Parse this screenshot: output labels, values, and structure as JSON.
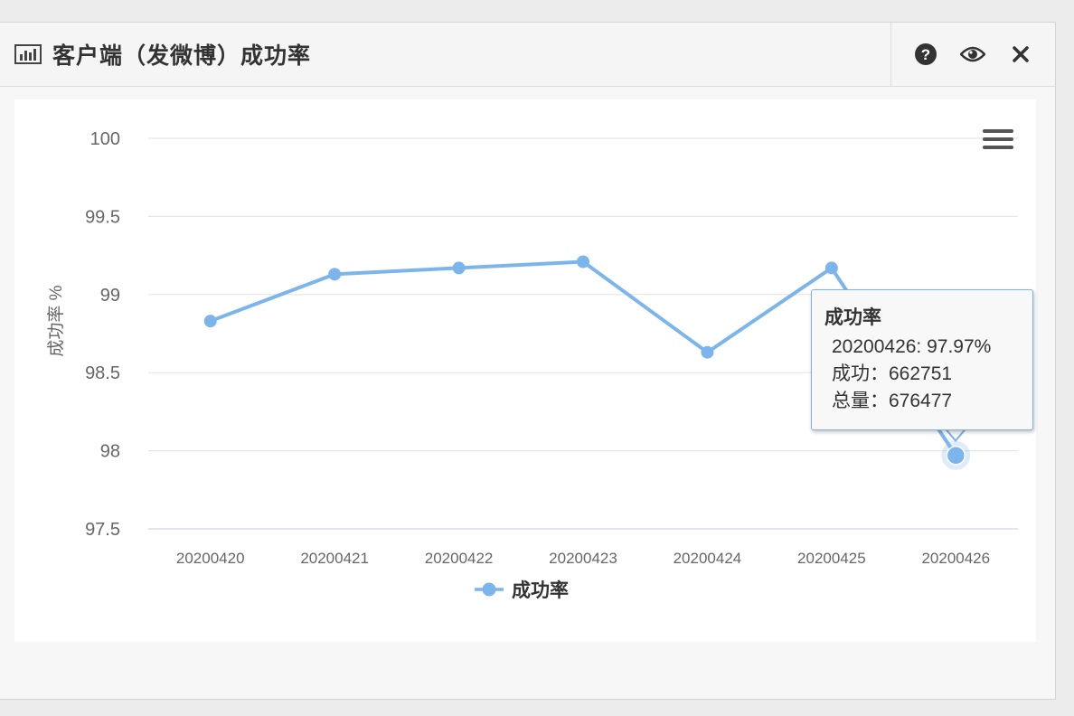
{
  "header": {
    "title": "客户端（发微博）成功率",
    "icons": [
      "bar-chart-icon",
      "help-icon",
      "eye-icon",
      "close-icon"
    ]
  },
  "colors": {
    "series": "#7cb5ec",
    "grid": "#e6e6e6",
    "axis_text": "#666666"
  },
  "chart_data": {
    "type": "line",
    "title": "",
    "ylabel": "成功率 %",
    "xlabel": "",
    "ylim": [
      97.5,
      100
    ],
    "yticks": [
      97.5,
      98,
      98.5,
      99,
      99.5,
      100
    ],
    "ytick_labels": [
      "97.5",
      "98",
      "98.5",
      "99",
      "99.5",
      "100"
    ],
    "categories": [
      "20200420",
      "20200421",
      "20200422",
      "20200423",
      "20200424",
      "20200425",
      "20200426"
    ],
    "series": [
      {
        "name": "成功率",
        "values": [
          98.83,
          99.13,
          99.17,
          99.21,
          98.63,
          99.17,
          97.97
        ]
      }
    ],
    "legend_position": "bottom-center",
    "grid": true
  },
  "tooltip": {
    "title": "成功率",
    "line1": "20200426: 97.97%",
    "line2": "成功：662751",
    "line3": "总量：676477"
  }
}
